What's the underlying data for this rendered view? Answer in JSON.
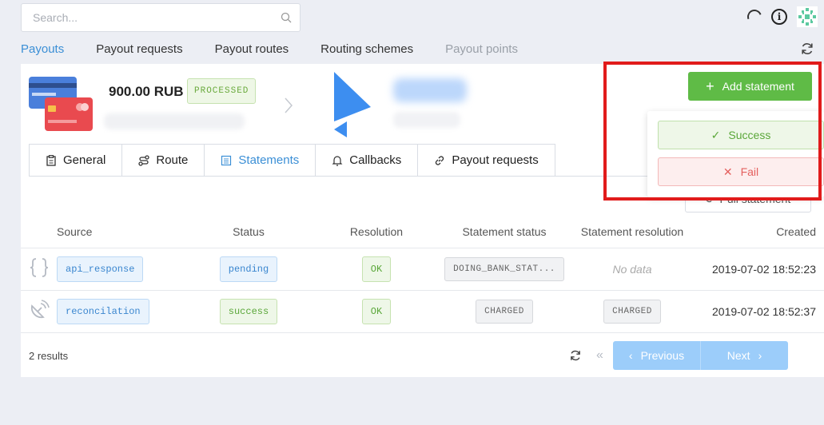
{
  "search": {
    "placeholder": "Search..."
  },
  "nav_tabs": [
    "Payouts",
    "Payout requests",
    "Payout routes",
    "Routing schemes",
    "Payout points"
  ],
  "payout": {
    "amount": "900.00 RUB",
    "status": "PROCESSED"
  },
  "subtabs": [
    "General",
    "Route",
    "Statements",
    "Callbacks",
    "Payout requests"
  ],
  "actions": {
    "add_statement": "Add statement",
    "full_statement": "Pull statement"
  },
  "dropdown": {
    "success": "Success",
    "fail": "Fail"
  },
  "table": {
    "headers": [
      "Source",
      "Status",
      "Resolution",
      "Statement status",
      "Statement resolution",
      "Created"
    ],
    "rows": [
      {
        "icon": "code-braces-icon",
        "source": "api_response",
        "status": "pending",
        "resolution": "OK",
        "statement_status": "DOING_BANK_STAT...",
        "statement_resolution": "No data",
        "created": "2019-07-02 18:52:23"
      },
      {
        "icon": "satellite-dish-icon",
        "source": "reconcilation",
        "status": "success",
        "resolution": "OK",
        "statement_status": "CHARGED",
        "statement_resolution": "CHARGED",
        "created": "2019-07-02 18:52:37"
      }
    ]
  },
  "footer": {
    "results": "2 results",
    "previous": "Previous",
    "next": "Next"
  },
  "colors": {
    "accent": "#3b8fd6",
    "primary_green": "#5fbb46",
    "highlight": "#e11b1b"
  }
}
